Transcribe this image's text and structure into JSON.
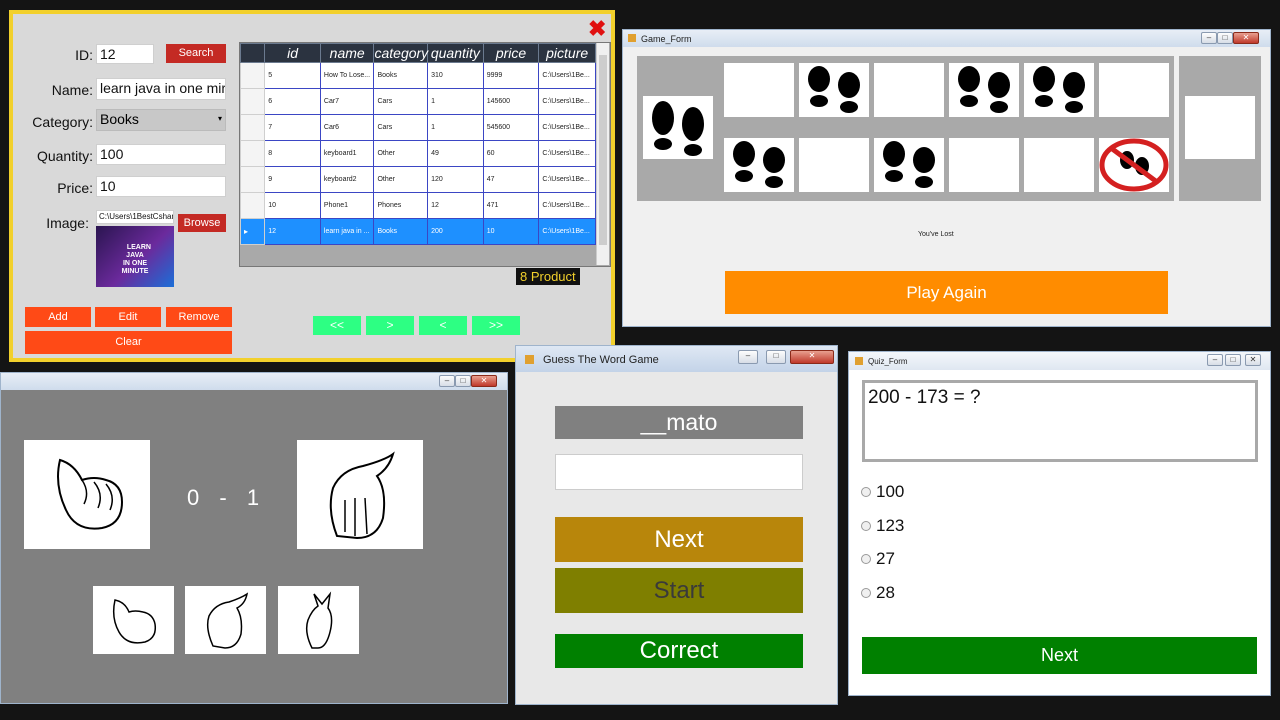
{
  "product_form": {
    "id_label": "ID:",
    "id_value": "12",
    "search_label": "Search",
    "name_label": "Name:",
    "name_value": "learn java in one mir",
    "category_label": "Category:",
    "category_value": "Books",
    "quantity_label": "Quantity:",
    "quantity_value": "100",
    "price_label": "Price:",
    "price_value": "10",
    "image_label": "Image:",
    "image_path": "C:\\Users\\1BestCsharp\\",
    "browse_label": "Browse",
    "image_text": "LEARN\nJAVA\nIN ONE\nMINUTE",
    "add_label": "Add",
    "edit_label": "Edit",
    "remove_label": "Remove",
    "clear_label": "Clear",
    "count_label": "8 Product",
    "nav": [
      "<<",
      ">",
      "<",
      ">>"
    ],
    "close_glyph": "✖",
    "columns": [
      "id",
      "name",
      "category",
      "quantity",
      "price",
      "picture"
    ],
    "rows": [
      [
        "5",
        "How To Lose...",
        "Books",
        "310",
        "9999",
        "C:\\Users\\1Be..."
      ],
      [
        "6",
        "Car7",
        "Cars",
        "1",
        "145600",
        "C:\\Users\\1Be..."
      ],
      [
        "7",
        "Car6",
        "Cars",
        "1",
        "545600",
        "C:\\Users\\1Be..."
      ],
      [
        "8",
        "keyboard1",
        "Other",
        "49",
        "60",
        "C:\\Users\\1Be..."
      ],
      [
        "9",
        "keyboard2",
        "Other",
        "120",
        "47",
        "C:\\Users\\1Be..."
      ],
      [
        "10",
        "Phone1",
        "Phones",
        "12",
        "471",
        "C:\\Users\\1Be..."
      ],
      [
        "12",
        "learn java in ...",
        "Books",
        "200",
        "10",
        "C:\\Users\\1Be..."
      ]
    ],
    "selected_row": 6
  },
  "game_form": {
    "title": "Game_Form",
    "status": "You've Lost",
    "play_again_label": "Play Again"
  },
  "rps_form": {
    "score_left": "0",
    "score_sep": "-",
    "score_right": "1"
  },
  "guess_form": {
    "title": "Guess The Word Game",
    "word": "__mato",
    "input_value": "",
    "next_label": "Next",
    "start_label": "Start",
    "correct_label": "Correct"
  },
  "quiz_form": {
    "title": "Quiz_Form",
    "question": "200 - 173 = ?",
    "options": [
      "100",
      "123",
      "27",
      "28"
    ],
    "next_label": "Next"
  },
  "colors": {
    "form_border": "#f2d02c",
    "red_button": "#ff4a16",
    "nav_green": "#2dff83",
    "orange": "#ff8c00",
    "gold": "#b8860b",
    "olive": "#7f7f00",
    "green": "#008000"
  }
}
